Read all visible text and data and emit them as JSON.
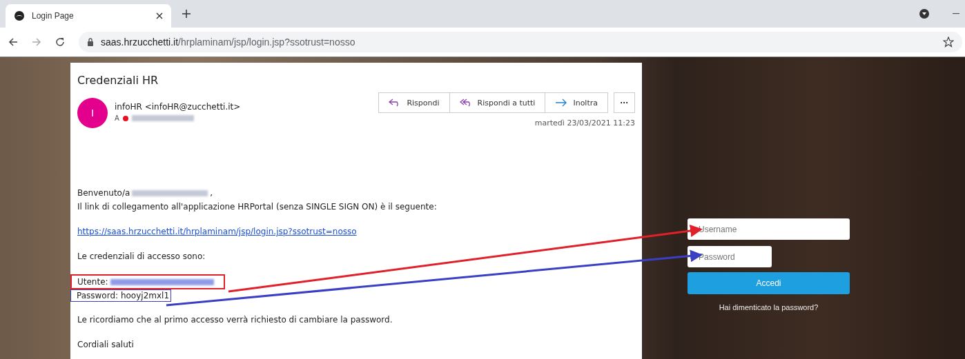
{
  "browser": {
    "tab": {
      "title": "Login Page",
      "selected": true
    },
    "url_host": "saas.hrzucchetti.it",
    "url_path": "/hrplaminam/jsp/login.jsp?ssotrust=nosso"
  },
  "email": {
    "subject": "Credenziali HR",
    "avatar_initial": "I",
    "sender": "infoHR <infoHR@zucchetti.it>",
    "to_label": "A",
    "date": "martedì 23/03/2021 11:23",
    "actions": [
      {
        "label": "Rispondi",
        "kind": "reply"
      },
      {
        "label": "Rispondi a tutti",
        "kind": "reply-all"
      },
      {
        "label": "Inoltra",
        "kind": "forward"
      }
    ],
    "more": "···",
    "greeting": "Benvenuto/a",
    "greeting_end": ",",
    "intro": "Il link di collegamento all'applicazione HRPortal (senza SINGLE SIGN ON) è il seguente:",
    "link": "https://saas.hrzucchetti.it/hrplaminam/jsp/login.jsp?ssotrust=nosso",
    "credentials_intro": "Le credenziali di accesso sono:",
    "user_label": "Utente:",
    "password_line": "Password: hooyj2mxl1",
    "reminder": "Le ricordiamo che al primo accesso verrà richiesto di cambiare la password.",
    "closing": "Cordiali saluti"
  },
  "login": {
    "username_placeholder": "Username",
    "password_placeholder": "Password",
    "submit": "Accedi",
    "forgot": "Hai dimenticato la password?"
  },
  "annotations": [
    {
      "color": "#e0202a"
    },
    {
      "color": "#3b3fc4"
    }
  ]
}
